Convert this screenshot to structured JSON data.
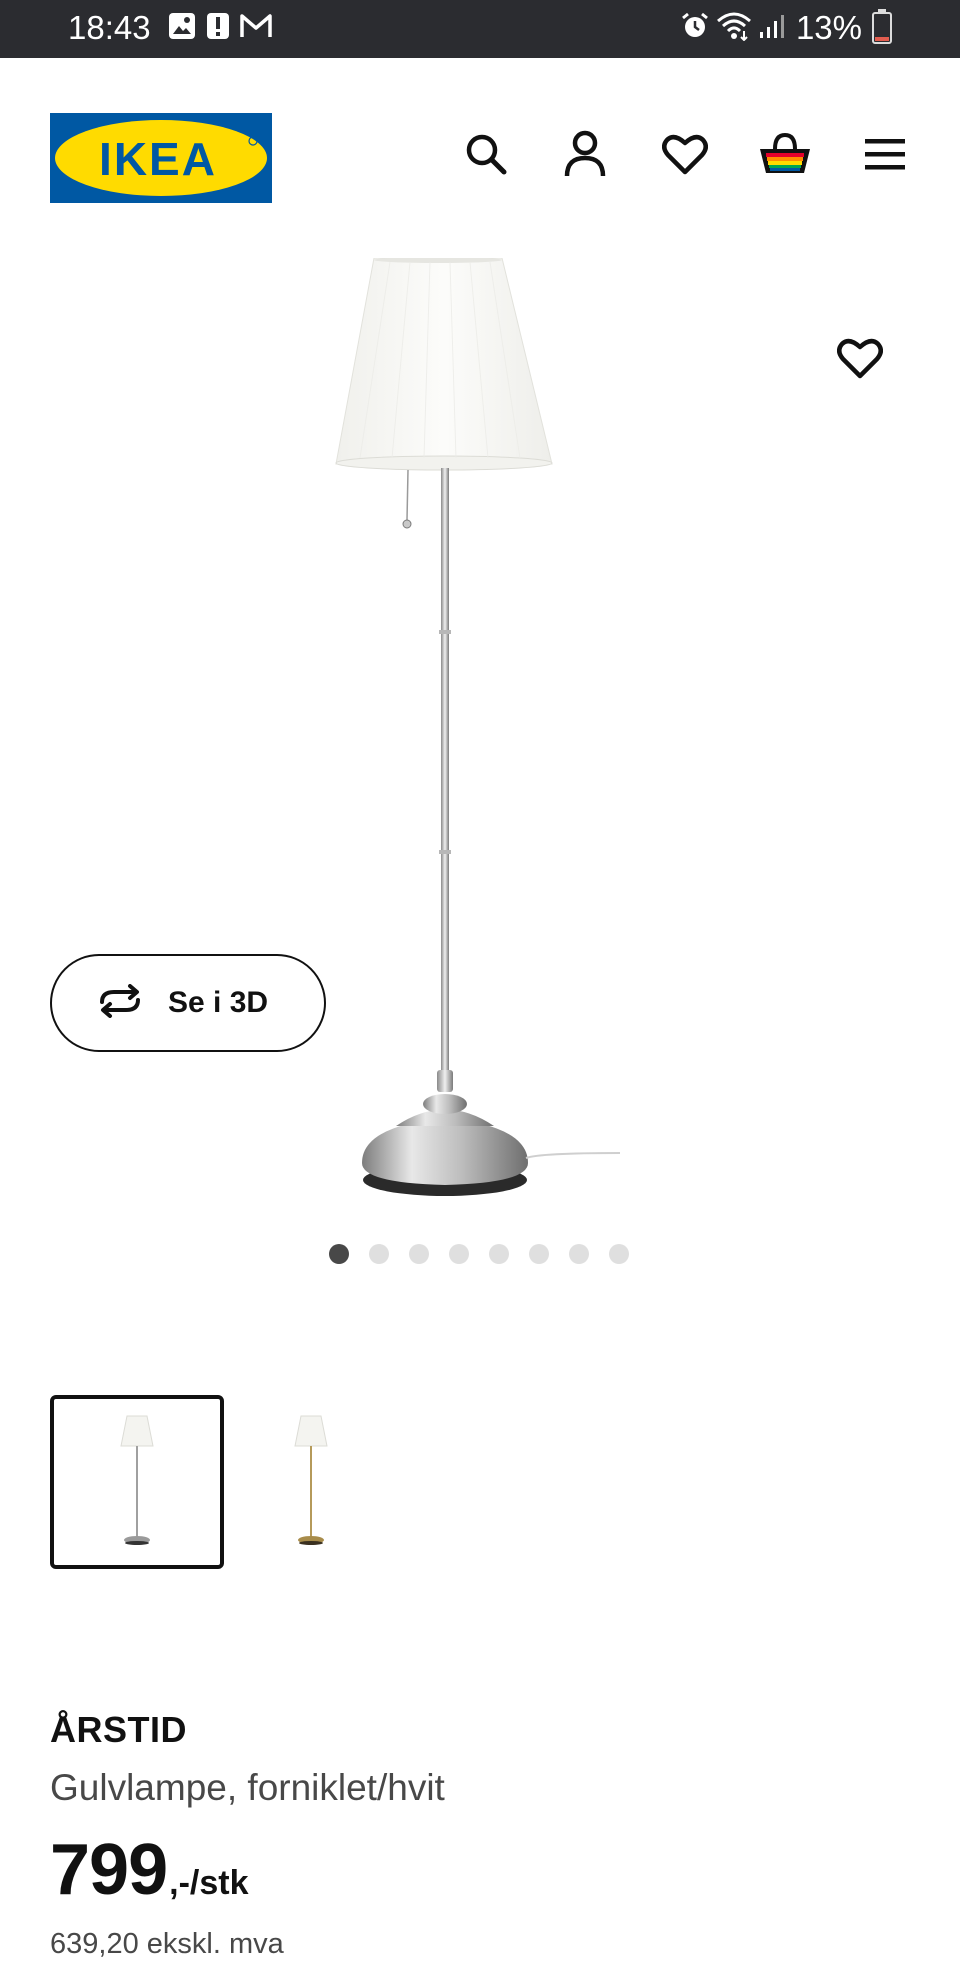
{
  "status_bar": {
    "time": "18:43",
    "battery_percent": "13%",
    "left_icons": [
      "image-icon",
      "alert-icon",
      "gmail-icon"
    ],
    "right_icons": [
      "alarm-icon",
      "wifi-icon",
      "signal-icon",
      "battery-icon"
    ],
    "battery_level": 0.13
  },
  "header": {
    "logo_text": "IKEA",
    "brand_colors": {
      "blue": "#0058a3",
      "yellow": "#ffdb00"
    },
    "icons": [
      "search-icon",
      "account-icon",
      "wishlist-icon",
      "cart-icon",
      "menu-icon"
    ]
  },
  "gallery": {
    "view_3d_label": "Se i 3D",
    "total_images": 8,
    "active_image": 1
  },
  "thumbnails": [
    {
      "variant": "forniklet/hvit",
      "selected": true
    },
    {
      "variant": "messing/hvit",
      "selected": false
    }
  ],
  "product": {
    "name": "ÅRSTID",
    "description": "Gulvlampe, forniklet/hvit",
    "price_integer": "799",
    "price_suffix": ",-/stk",
    "price_ex_vat": "639,20 ekskl. mva"
  }
}
